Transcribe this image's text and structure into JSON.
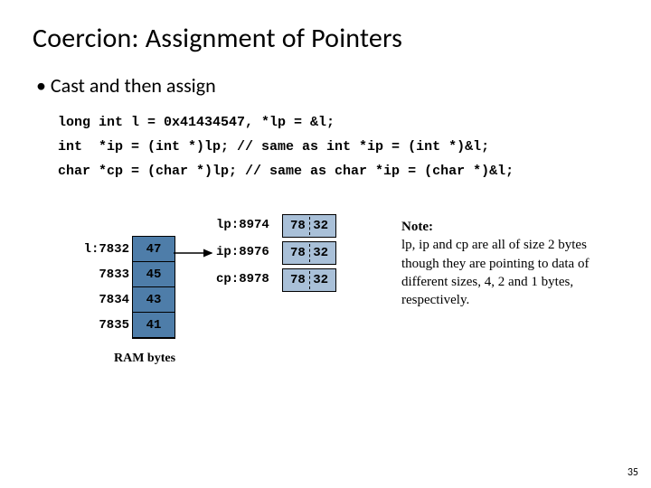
{
  "title": "Coercion: Assignment of Pointers",
  "bullet": "• Cast and then assign",
  "code": {
    "line1": "long int l = 0x41434547, *lp = &l;",
    "line2": "int  *ip = (int *)lp; // same as int *ip = (int *)&l;",
    "line3": "char *cp = (char *)lp; // same as char *ip = (char *)&l;"
  },
  "mem": {
    "cells": [
      "47",
      "45",
      "43",
      "41"
    ],
    "addrs": [
      "l:7832",
      "7833",
      "7834",
      "7835"
    ],
    "label": "RAM bytes"
  },
  "ptrs": {
    "lp": {
      "label": "lp:8974",
      "val": "78 32"
    },
    "ip": {
      "label": "ip:8976",
      "val": "78 32"
    },
    "cp": {
      "label": "cp:8978",
      "val": "78 32"
    }
  },
  "note": {
    "heading": "Note:",
    "body": "lp, ip and cp are all of size 2 bytes though they are pointing to data of different sizes, 4, 2 and 1 bytes, respectively."
  },
  "slidenum": "35"
}
